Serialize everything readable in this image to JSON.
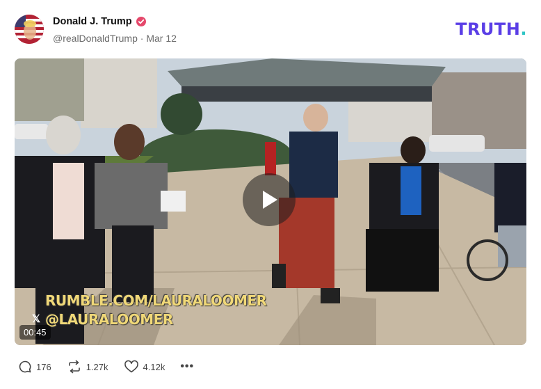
{
  "post": {
    "author_name": "Donald J. Trump",
    "handle": "@realDonaldTrump",
    "separator": " · ",
    "date": "Mar 12",
    "verified_color": "#e5486b"
  },
  "brand": {
    "logo_main": "TRUTH",
    "logo_dot": ".",
    "primary_color": "#5a3ee6",
    "accent_color": "#2ec5c5"
  },
  "video": {
    "duration": "00:45",
    "overlay_line1": "RUMBLE.COM/LAURALOOMER",
    "overlay_line2": "@LAURALOOMER",
    "overlay_prefix_icon": "x-logo-icon",
    "play_icon": "play-icon"
  },
  "actions": {
    "replies": "176",
    "reposts": "1.27k",
    "likes": "4.12k",
    "more": "•••"
  }
}
